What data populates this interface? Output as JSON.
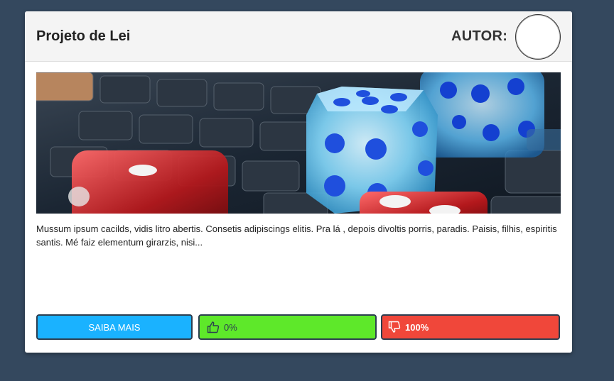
{
  "card": {
    "title": "Projeto de Lei",
    "author_label": "AUTOR:",
    "description": "Mussum ipsum cacilds, vidis litro abertis. Consetis adipiscings elitis. Pra lá , depois divoltis porris, paradis. Paisis, filhis, espiritis santis. Mé faiz elementum girarzis, nisi..."
  },
  "buttons": {
    "more_label": "SAIBA MAIS",
    "like_value": "0%",
    "dislike_value": "100%"
  },
  "icons": {
    "like": "thumbs-up-icon",
    "dislike": "thumbs-down-icon"
  },
  "colors": {
    "background": "#34485e",
    "more_button": "#1ab2ff",
    "like_button": "#5ee82a",
    "dislike_button": "#f0473a"
  }
}
